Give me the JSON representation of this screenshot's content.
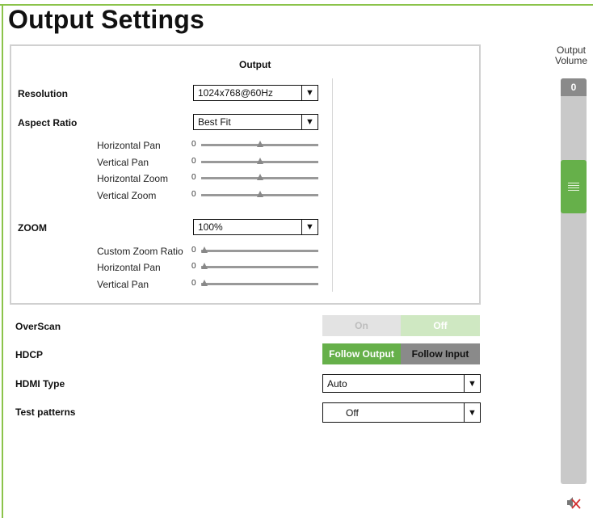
{
  "page": {
    "title": "Output Settings"
  },
  "output_panel": {
    "header": "Output",
    "resolution": {
      "label": "Resolution",
      "value": "1024x768@60Hz"
    },
    "aspect_ratio": {
      "label": "Aspect Ratio",
      "value": "Best Fit",
      "sliders": [
        {
          "label": "Horizontal Pan",
          "value": "0",
          "level": 0.5
        },
        {
          "label": "Vertical Pan",
          "value": "0",
          "level": 0.5
        },
        {
          "label": "Horizontal Zoom",
          "value": "0",
          "level": 0.5
        },
        {
          "label": "Vertical Zoom",
          "value": "0",
          "level": 0.5
        }
      ]
    },
    "zoom": {
      "label": "ZOOM",
      "value": "100%",
      "sliders": [
        {
          "label": "Custom Zoom Ratio",
          "value": "0",
          "level": 0
        },
        {
          "label": "Horizontal Pan",
          "value": "0",
          "level": 0
        },
        {
          "label": "Vertical Pan",
          "value": "0",
          "level": 0
        }
      ]
    }
  },
  "overscan": {
    "label": "OverScan",
    "on_label": "On",
    "off_label": "Off",
    "selected": "Off"
  },
  "hdcp": {
    "label": "HDCP",
    "option1": "Follow Output",
    "option2": "Follow Input",
    "selected": "Follow Output"
  },
  "hdmi_type": {
    "label": "HDMI Type",
    "value": "Auto"
  },
  "test_patterns": {
    "label": "Test patterns",
    "value": "Off"
  },
  "volume": {
    "label_line1": "Output",
    "label_line2": "Volume",
    "value": "0",
    "level": 0.21
  },
  "icons": {
    "dropdown": "chevron-down-icon",
    "mute": "speaker-muted-icon",
    "grip": "grip-lines-icon"
  },
  "colors": {
    "accent_green": "#66b04a",
    "frame_green": "#8bc34a",
    "toggle_gray": "#8a8a8a"
  }
}
